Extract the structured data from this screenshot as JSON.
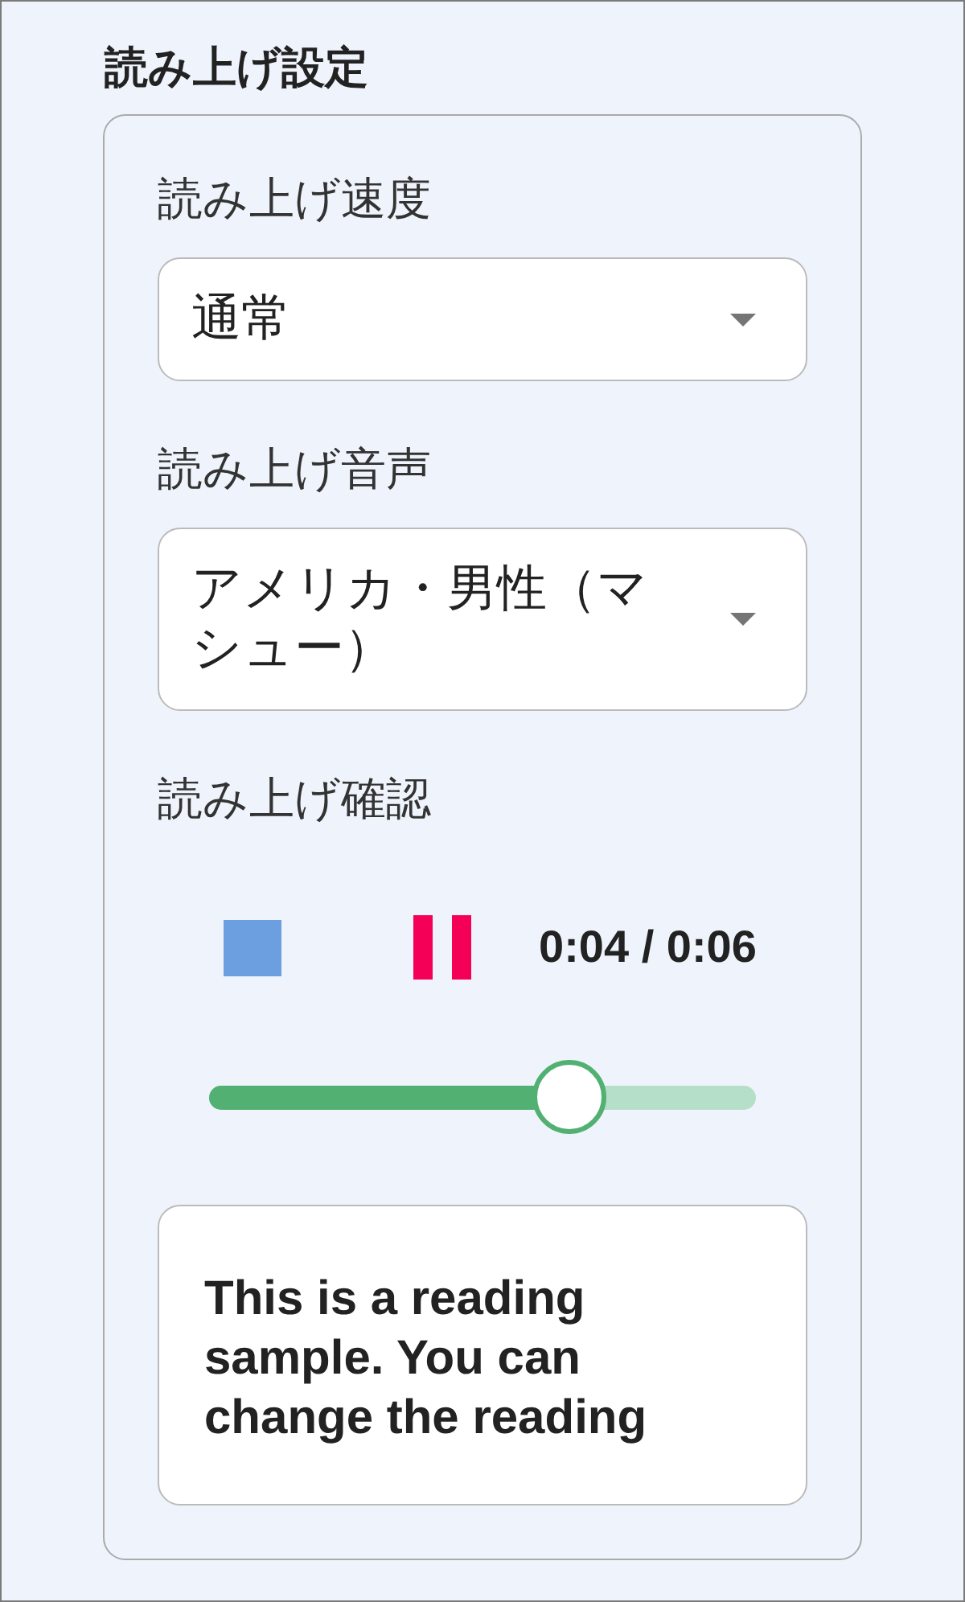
{
  "title": "読み上げ設定",
  "dropdowns": [
    {
      "label": "読み上げ速度",
      "value": "通常"
    },
    {
      "label": "読み上げ音声",
      "value": "アメリカ・男性（マシュー）"
    }
  ],
  "preview": {
    "label": "読み上げ確認",
    "playing": true,
    "time": "0:04 / 0:06",
    "level": 0.66,
    "sample_text": "This is a reading sample. You can change the reading"
  }
}
